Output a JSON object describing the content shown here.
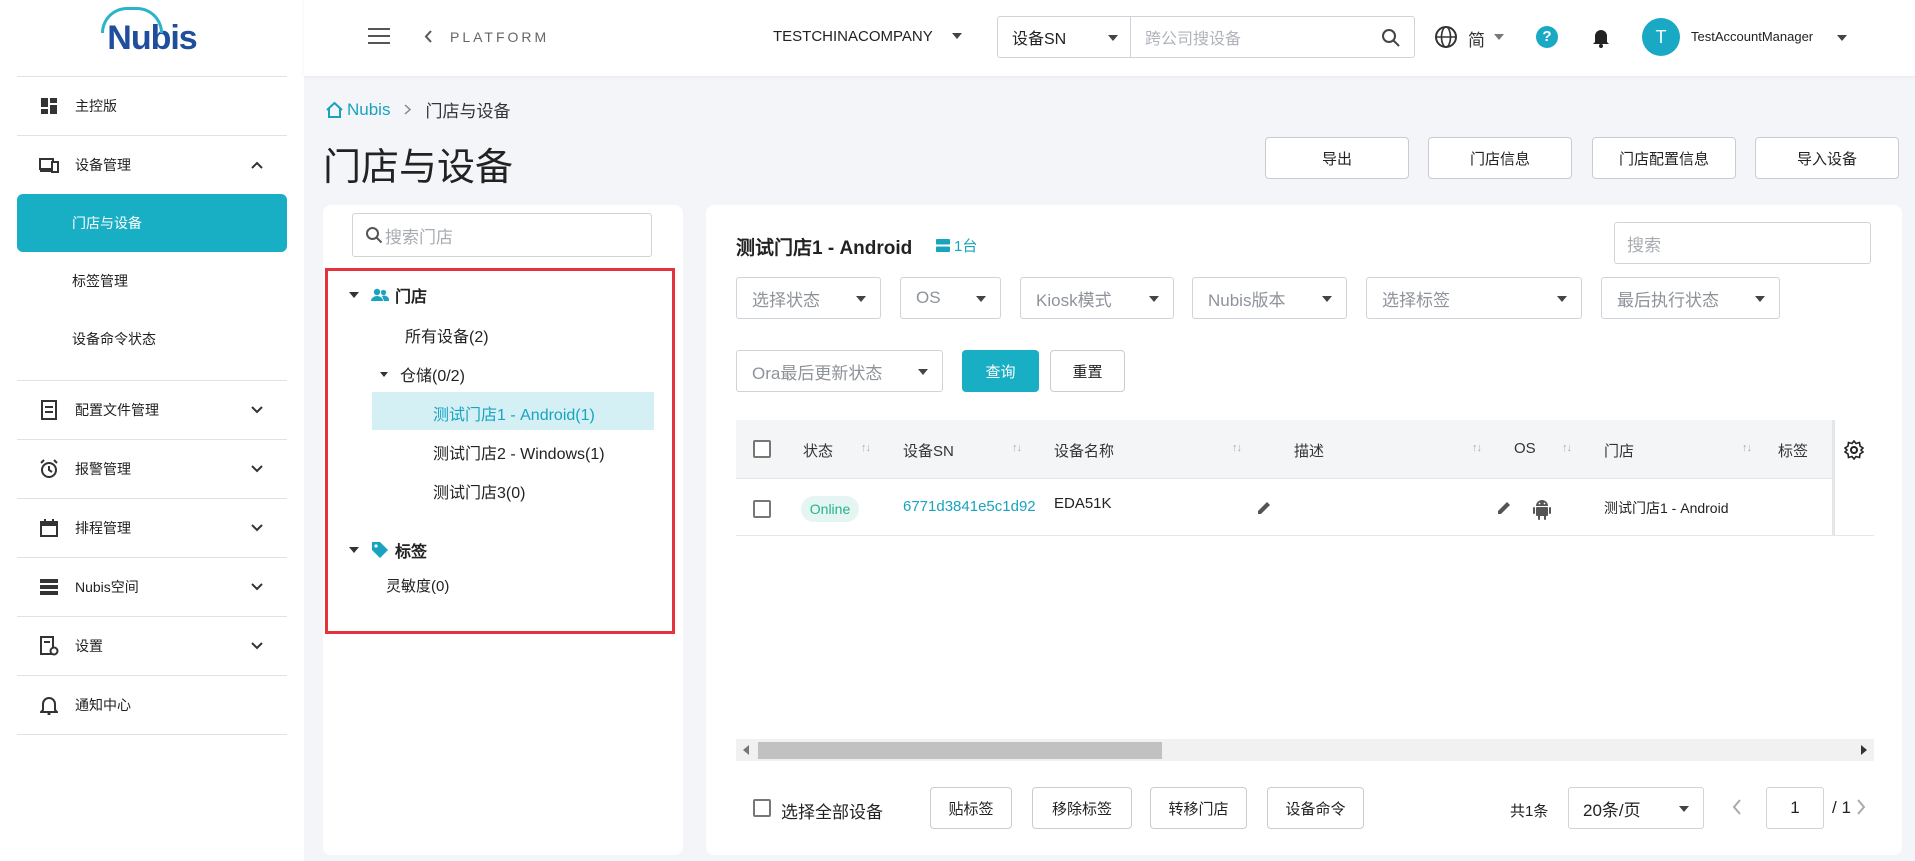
{
  "logo": {
    "text": "Nubis"
  },
  "sidebar": {
    "items": [
      {
        "label": "主控版"
      },
      {
        "label": "设备管理"
      },
      {
        "label": "门店与设备"
      },
      {
        "label": "标签管理"
      },
      {
        "label": "设备命令状态"
      },
      {
        "label": "配置文件管理"
      },
      {
        "label": "报警管理"
      },
      {
        "label": "排程管理"
      },
      {
        "label": "Nubis空间"
      },
      {
        "label": "设置"
      },
      {
        "label": "通知中心"
      }
    ]
  },
  "header": {
    "platform": "PLATFORM",
    "company": "TESTCHINACOMPANY",
    "search_type": "设备SN",
    "search_placeholder": "跨公司搜设备",
    "lang": "简",
    "help": "?",
    "avatar_initial": "T",
    "username": "TestAccountManager"
  },
  "breadcrumb": {
    "home": "Nubis",
    "current": "门店与设备"
  },
  "page_title": "门店与设备",
  "top_buttons": {
    "export": "导出",
    "store_info": "门店信息",
    "store_config": "门店配置信息",
    "import": "导入设备"
  },
  "tree": {
    "search_placeholder": "搜索门店",
    "stores_heading": "门店",
    "all_devices": "所有设备(2)",
    "warehouse": "仓储(0/2)",
    "store1": "测试门店1 - Android(1)",
    "store2": "测试门店2 - Windows(1)",
    "store3": "测试门店3(0)",
    "tags_heading": "标签",
    "tag1": "灵敏度(0)"
  },
  "main": {
    "store_title": "测试门店1 - Android",
    "count": "1台",
    "search_placeholder": "搜索",
    "filters": {
      "status": "选择状态",
      "os": "OS",
      "kiosk": "Kiosk模式",
      "nubis_version": "Nubis版本",
      "tag": "选择标签",
      "last_exec": "最后执行状态",
      "ora": "Ora最后更新状态"
    },
    "query_btn": "查询",
    "reset_btn": "重置",
    "columns": {
      "status": "状态",
      "sn": "设备SN",
      "name": "设备名称",
      "desc": "描述",
      "os": "OS",
      "store": "门店",
      "tag": "标签"
    },
    "row": {
      "status": "Online",
      "sn": "6771d3841e5c1d92",
      "name": "EDA51K",
      "store": "测试门店1 - Android"
    },
    "footer": {
      "select_all": "选择全部设备",
      "add_tag": "贴标签",
      "remove_tag": "移除标签",
      "move_store": "转移门店",
      "device_cmd": "设备命令",
      "total": "共1条",
      "per_page": "20条/页",
      "page": "1",
      "total_pages": "/ 1"
    }
  }
}
